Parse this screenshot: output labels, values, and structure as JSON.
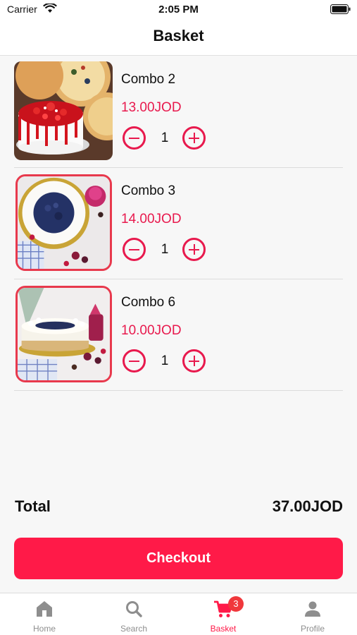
{
  "status_bar": {
    "carrier": "Carrier",
    "time": "2:05 PM"
  },
  "header": {
    "title": "Basket"
  },
  "basket": {
    "items": [
      {
        "name": "Combo 2",
        "price": "13.00JOD",
        "quantity": "1",
        "image": "cake-with-pizzas"
      },
      {
        "name": "Combo 3",
        "price": "14.00JOD",
        "quantity": "1",
        "image": "blueberry-cake-top-view"
      },
      {
        "name": "Combo 6",
        "price": "10.00JOD",
        "quantity": "1",
        "image": "blueberry-cheesecake"
      }
    ]
  },
  "summary": {
    "total_label": "Total",
    "total_value": "37.00JOD"
  },
  "checkout": {
    "label": "Checkout"
  },
  "tabs": [
    {
      "label": "Home",
      "icon": "home-icon"
    },
    {
      "label": "Search",
      "icon": "search-icon"
    },
    {
      "label": "Basket",
      "icon": "cart-icon",
      "badge": "3",
      "active": true
    },
    {
      "label": "Profile",
      "icon": "person-icon"
    }
  ],
  "colors": {
    "accent": "#ff1a48",
    "price": "#e8194d",
    "badge": "#f0383c",
    "inactive_tab": "#8e8e8e"
  }
}
